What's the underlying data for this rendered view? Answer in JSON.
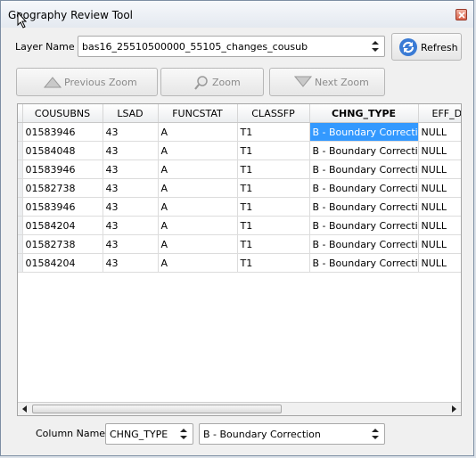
{
  "window": {
    "title": "Geography Review Tool"
  },
  "layer": {
    "label": "Layer Name :",
    "selected": "bas16_25510500000_55105_changes_cousub",
    "refresh_label": "Refresh"
  },
  "zoom": {
    "previous_label": "Previous Zoom",
    "zoom_label": "Zoom",
    "next_label": "Next Zoom"
  },
  "table": {
    "columns": [
      "COUSUBNS",
      "LSAD",
      "FUNCSTAT",
      "CLASSFP",
      "CHNG_TYPE",
      "EFF_D"
    ],
    "rows": [
      [
        "01583946",
        "43",
        "A",
        "T1",
        "B - Boundary Correction",
        "NULL"
      ],
      [
        "01584048",
        "43",
        "A",
        "T1",
        "B - Boundary Correction",
        "NULL"
      ],
      [
        "01583946",
        "43",
        "A",
        "T1",
        "B - Boundary Correction",
        "NULL"
      ],
      [
        "01582738",
        "43",
        "A",
        "T1",
        "B - Boundary Correction",
        "NULL"
      ],
      [
        "01583946",
        "43",
        "A",
        "T1",
        "B - Boundary Correction",
        "NULL"
      ],
      [
        "01584204",
        "43",
        "A",
        "T1",
        "B - Boundary Correction",
        "NULL"
      ],
      [
        "01582738",
        "43",
        "A",
        "T1",
        "B - Boundary Correction",
        "NULL"
      ],
      [
        "01584204",
        "43",
        "A",
        "T1",
        "B - Boundary Correction",
        "NULL"
      ]
    ]
  },
  "filter": {
    "label": "Column Name :",
    "column": "CHNG_TYPE",
    "value": "B - Boundary Correction"
  },
  "colors": {
    "selection": "#3399ff",
    "selection_text": "#ffffff"
  }
}
